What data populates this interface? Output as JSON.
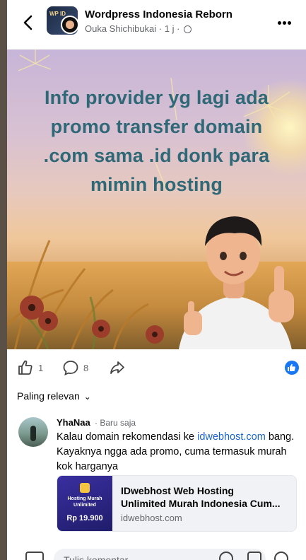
{
  "header": {
    "group_name": "Wordpress Indonesia Reborn",
    "author": "Ouka Shichibukai",
    "time": "1 j"
  },
  "post": {
    "image_text": "Info provider yg lagi ada promo transfer domain .com sama .id donk para mimin hosting"
  },
  "actions": {
    "like_count": "1",
    "comment_count": "8"
  },
  "sort": {
    "label": "Paling relevan"
  },
  "comment": {
    "name": "YhaNaa",
    "time": "Baru saja",
    "text_before_link": "Kalau domain rekomendasi ke ",
    "link": "idwebhost.com",
    "text_after_link": " bang. Kayaknya ngga ada promo, cuma termasuk murah kok harganya"
  },
  "link_card": {
    "thumb_title": "Hosting Murah Unlimited",
    "thumb_price": "Rp 19.900",
    "title_line1": "IDwebhost Web Hosting",
    "title_line2": "Unlimited Murah Indonesia Cum...",
    "domain": "idwebhost.com"
  },
  "composer": {
    "placeholder": "Tulis komentar..."
  },
  "colors": {
    "facebook_blue": "#1877f2",
    "link_blue": "#1a63c6",
    "post_text": "#2f6876",
    "secondary_text": "#65676b"
  }
}
